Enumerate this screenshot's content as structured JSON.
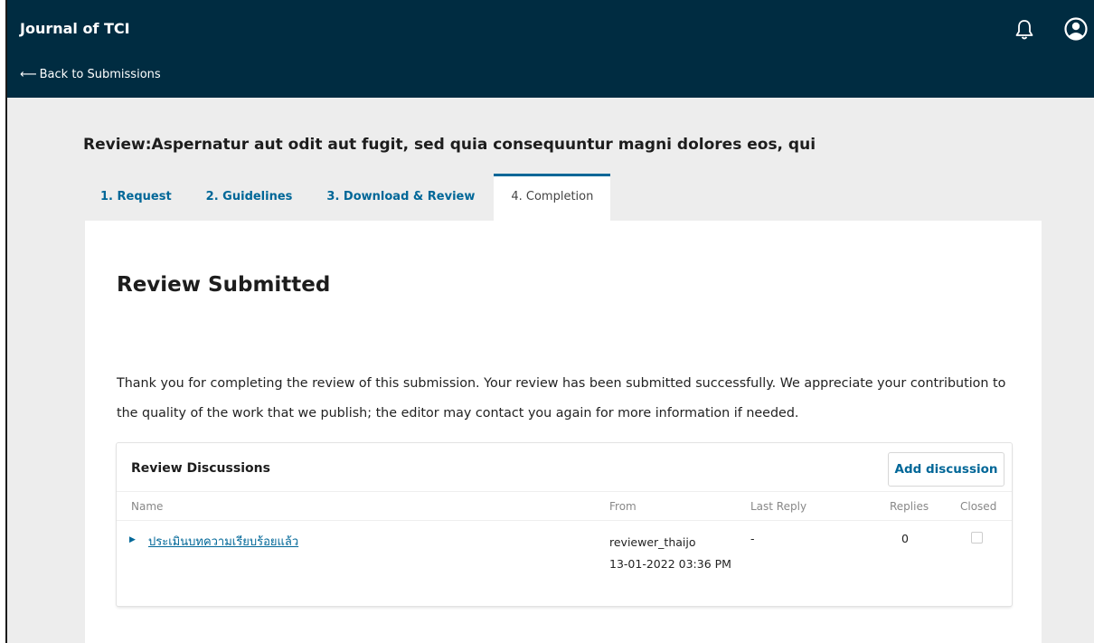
{
  "header": {
    "app_title": "Journal of TCI",
    "back_label": "Back to Submissions"
  },
  "page": {
    "title": "Review:Aspernatur aut odit aut fugit, sed quia consequuntur magni dolores eos, qui"
  },
  "tabs": [
    {
      "label": "1. Request",
      "active": false
    },
    {
      "label": "2. Guidelines",
      "active": false
    },
    {
      "label": "3. Download & Review",
      "active": false
    },
    {
      "label": "4. Completion",
      "active": true
    }
  ],
  "completion": {
    "heading": "Review Submitted",
    "message": "Thank you for completing the review of this submission. Your review has been submitted successfully. We appreciate your contribution to the quality of the work that we publish; the editor may contact you again for more information if needed."
  },
  "discussions": {
    "title": "Review Discussions",
    "add_label": "Add discussion",
    "columns": {
      "name": "Name",
      "from": "From",
      "last_reply": "Last Reply",
      "replies": "Replies",
      "closed": "Closed"
    },
    "rows": [
      {
        "topic": "ประเมินบทความเรียบร้อยแล้ว",
        "from_user": "reviewer_thaijo",
        "from_date": "13-01-2022 03:36 PM",
        "last_reply": "-",
        "replies": "0",
        "closed": false
      }
    ]
  },
  "colors": {
    "header_bg": "#002c41",
    "accent": "#006798",
    "page_bg": "#ededed"
  },
  "icons": {
    "notifications": "bell-icon",
    "user": "user-circle-icon",
    "back": "arrow-left-icon",
    "expander": "triangle-right-icon"
  }
}
